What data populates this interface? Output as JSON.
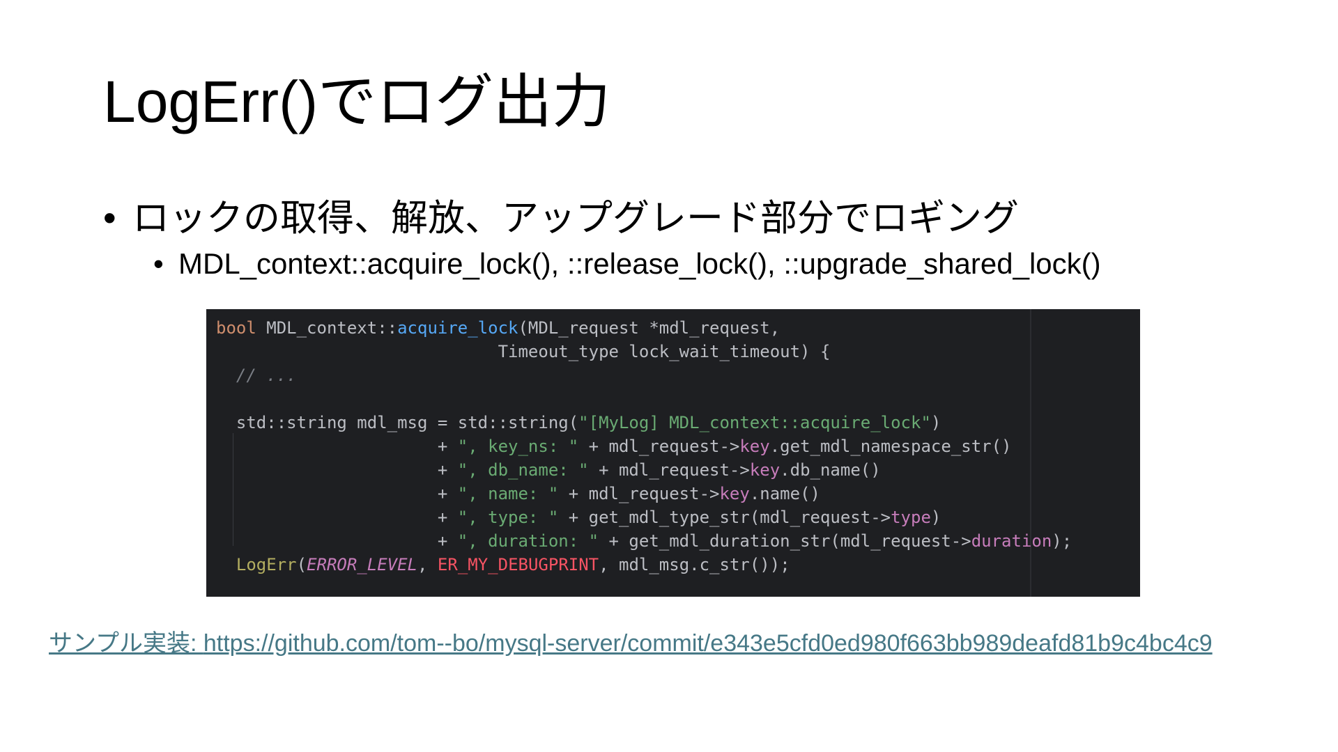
{
  "slide": {
    "title": "LogErr()でログ出力",
    "bullet_main": "ロックの取得、解放、アップグレード部分でロギング",
    "bullet_sub": "MDL_context::acquire_lock(), ::release_lock(), ::upgrade_shared_lock()",
    "link_label": "サンプル実装: ",
    "link_url": "https://github.com/tom--bo/mysql-server/commit/e343e5cfd0ed980f663bb989deafd81b9c4bc4c9"
  },
  "code": {
    "lines": [
      [
        {
          "t": "bool",
          "c": "kw"
        },
        {
          "t": " MDL_context::",
          "c": ""
        },
        {
          "t": "acquire_lock",
          "c": "fn"
        },
        {
          "t": "(MDL_request *mdl_request,",
          "c": ""
        }
      ],
      [
        {
          "t": "                            Timeout_type lock_wait_timeout) {",
          "c": ""
        }
      ],
      [
        {
          "t": "  // ...",
          "c": "cmt"
        }
      ],
      [],
      [
        {
          "t": "  std::string mdl_msg = std::string(",
          "c": ""
        },
        {
          "t": "\"[MyLog] MDL_context::acquire_lock\"",
          "c": "str"
        },
        {
          "t": ")",
          "c": ""
        }
      ],
      [
        {
          "t": "                      + ",
          "c": ""
        },
        {
          "t": "\", key_ns: \"",
          "c": "str"
        },
        {
          "t": " + mdl_request->",
          "c": ""
        },
        {
          "t": "key",
          "c": "field"
        },
        {
          "t": ".get_mdl_namespace_str()",
          "c": ""
        }
      ],
      [
        {
          "t": "                      + ",
          "c": ""
        },
        {
          "t": "\", db_name: \"",
          "c": "str"
        },
        {
          "t": " + mdl_request->",
          "c": ""
        },
        {
          "t": "key",
          "c": "field"
        },
        {
          "t": ".db_name()",
          "c": ""
        }
      ],
      [
        {
          "t": "                      + ",
          "c": ""
        },
        {
          "t": "\", name: \"",
          "c": "str"
        },
        {
          "t": " + mdl_request->",
          "c": ""
        },
        {
          "t": "key",
          "c": "field"
        },
        {
          "t": ".name()",
          "c": ""
        }
      ],
      [
        {
          "t": "                      + ",
          "c": ""
        },
        {
          "t": "\", type: \"",
          "c": "str"
        },
        {
          "t": " + get_mdl_type_str(mdl_request->",
          "c": ""
        },
        {
          "t": "type",
          "c": "field"
        },
        {
          "t": ")",
          "c": ""
        }
      ],
      [
        {
          "t": "                      + ",
          "c": ""
        },
        {
          "t": "\", duration: \"",
          "c": "str"
        },
        {
          "t": " + get_mdl_duration_str(mdl_request->",
          "c": ""
        },
        {
          "t": "duration",
          "c": "field"
        },
        {
          "t": ");",
          "c": ""
        }
      ],
      [
        {
          "t": "  ",
          "c": ""
        },
        {
          "t": "LogErr",
          "c": "macro"
        },
        {
          "t": "(",
          "c": ""
        },
        {
          "t": "ERROR_LEVEL",
          "c": "const"
        },
        {
          "t": ", ",
          "c": ""
        },
        {
          "t": "ER_MY_DEBUGPRINT",
          "c": "err"
        },
        {
          "t": ", mdl_msg.c_str());",
          "c": ""
        }
      ]
    ]
  },
  "colors": {
    "code_bg": "#1e1f22",
    "keyword": "#cf8e6d",
    "function": "#56a8f5",
    "string": "#6aab73",
    "field": "#c77dbb",
    "macro": "#b3ae60",
    "error_const": "#f75464",
    "link": "#467886"
  }
}
